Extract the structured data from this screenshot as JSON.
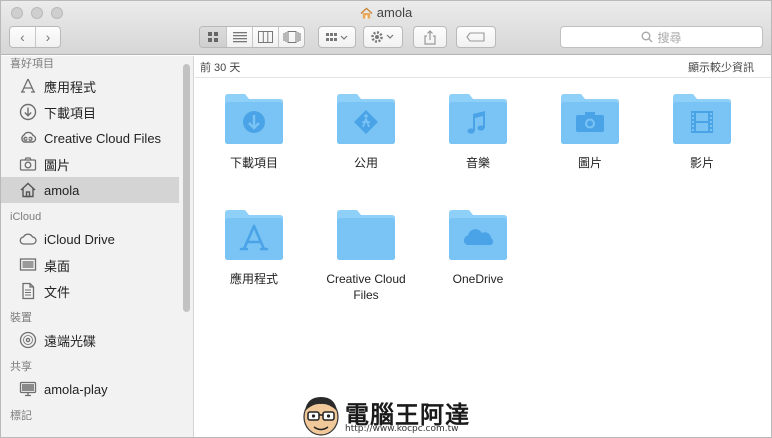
{
  "window": {
    "title": "amola"
  },
  "toolbar": {
    "back_symbol": "‹",
    "forward_symbol": "›",
    "search_placeholder": "搜尋"
  },
  "sidebar": {
    "sections": [
      {
        "title": "喜好項目",
        "items": [
          {
            "label": "應用程式",
            "icon": "apps-icon"
          },
          {
            "label": "下載項目",
            "icon": "download-icon"
          },
          {
            "label": "Creative Cloud Files",
            "icon": "creative-cloud-icon"
          },
          {
            "label": "圖片",
            "icon": "camera-icon"
          },
          {
            "label": "amola",
            "icon": "home-icon",
            "selected": true
          }
        ]
      },
      {
        "title": "iCloud",
        "items": [
          {
            "label": "iCloud Drive",
            "icon": "cloud-icon"
          },
          {
            "label": "桌面",
            "icon": "desktop-icon"
          },
          {
            "label": "文件",
            "icon": "document-icon"
          }
        ]
      },
      {
        "title": "裝置",
        "items": [
          {
            "label": "遠端光碟",
            "icon": "disc-icon"
          }
        ]
      },
      {
        "title": "共享",
        "items": [
          {
            "label": "amola-play",
            "icon": "monitor-icon"
          }
        ]
      },
      {
        "title": "標記",
        "items": []
      }
    ]
  },
  "main": {
    "header_left": "前 30 天",
    "header_right": "顯示較少資訊",
    "folders": [
      {
        "label": "下載項目",
        "icon": "download-icon"
      },
      {
        "label": "公用",
        "icon": "public-icon"
      },
      {
        "label": "音樂",
        "icon": "music-icon"
      },
      {
        "label": "圖片",
        "icon": "camera-icon"
      },
      {
        "label": "影片",
        "icon": "film-icon"
      },
      {
        "label": "應用程式",
        "icon": "apps-icon"
      },
      {
        "label": "Creative Cloud\nFiles",
        "icon": "none"
      },
      {
        "label": "OneDrive",
        "icon": "onedrive-icon"
      }
    ]
  },
  "watermark": {
    "title": "電腦王阿達",
    "url": "http://www.kocpc.com.tw"
  },
  "colors": {
    "folder": "#7ac4f5",
    "folder_tab": "#8fd0f9",
    "folder_glyph": "#4aa3e6",
    "selected": "#d4d4d4"
  }
}
